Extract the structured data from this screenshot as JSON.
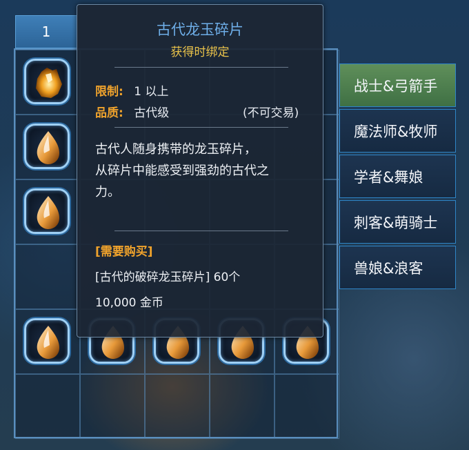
{
  "inventory": {
    "tab_number": "1"
  },
  "side_tabs": [
    {
      "label": "战士&弓箭手",
      "active": true
    },
    {
      "label": "魔法师&牧师",
      "active": false
    },
    {
      "label": "学者&舞娘",
      "active": false
    },
    {
      "label": "刺客&萌骑士",
      "active": false
    },
    {
      "label": "兽娘&浪客",
      "active": false
    }
  ],
  "tooltip": {
    "title": "古代龙玉碎片",
    "bind": "获得时绑定",
    "restriction_label": "限制:",
    "restriction_value": "1 以上",
    "quality_label": "品质:",
    "quality_value": "古代级",
    "trade_status": "(不可交易)",
    "description_line1": "古代人随身携带的龙玉碎片，",
    "description_line2": "从碎片中能感受到强劲的古代之",
    "description_line3": "力。",
    "purchase_heading": "[需要购买]",
    "purchase_item": "[古代的破碎龙玉碎片] 60个",
    "purchase_price": "10,000 金币"
  },
  "colors": {
    "title": "#6eaee8",
    "bind": "#e9c24a",
    "label": "#f0a32c",
    "active_tab": "#4f8050",
    "tab_border": "#2f86c8"
  },
  "icons": {
    "item": "dragon-jade-shard-icon"
  }
}
